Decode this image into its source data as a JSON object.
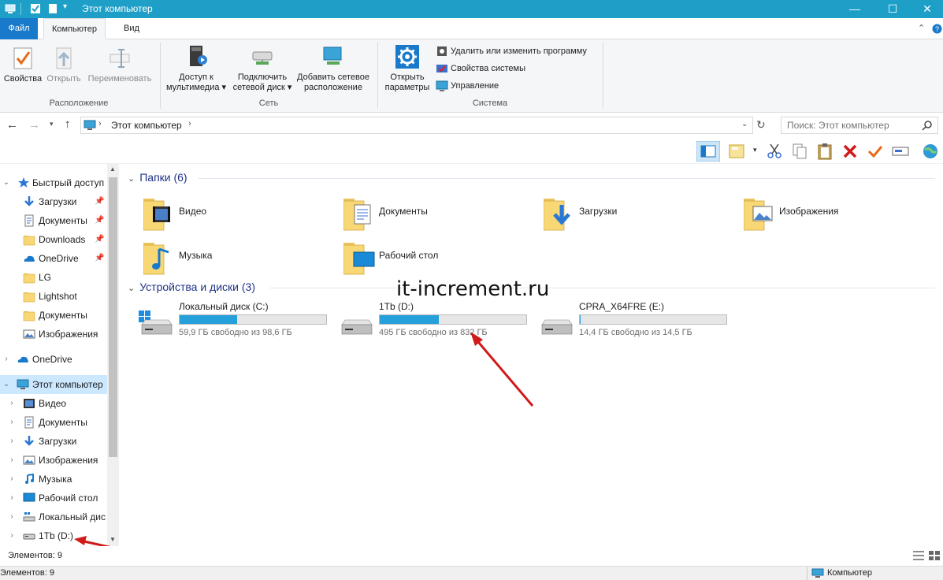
{
  "window": {
    "title": "Этот компьютер",
    "controls": [
      "—",
      "☐",
      "✕"
    ]
  },
  "ribbon_tabs": [
    "Файл",
    "Компьютер",
    "Вид"
  ],
  "ribbon": {
    "location": {
      "label": "Расположение",
      "buttons": [
        {
          "label": "Свойства",
          "enabled": true
        },
        {
          "label": "Открыть",
          "enabled": false
        },
        {
          "label": "Переименовать",
          "enabled": false
        }
      ]
    },
    "network": {
      "label": "Сеть",
      "buttons": [
        {
          "line1": "Доступ к",
          "line2": "мультимедиа ▾"
        },
        {
          "line1": "Подключить",
          "line2": "сетевой диск ▾"
        },
        {
          "line1": "Добавить сетевое",
          "line2": "расположение"
        }
      ]
    },
    "system": {
      "label": "Система",
      "open_settings": {
        "line1": "Открыть",
        "line2": "параметры"
      },
      "items": [
        "Удалить или изменить программу",
        "Свойства системы",
        "Управление"
      ]
    }
  },
  "address": {
    "path": "Этот компьютер",
    "search_placeholder": "Поиск: Этот компьютер"
  },
  "nav": {
    "quick_access": "Быстрый доступ",
    "quick_items": [
      "Загрузки",
      "Документы",
      "Downloads",
      "OneDrive",
      "LG",
      "Lightshot",
      "Документы",
      "Изображения"
    ],
    "onedrive": "OneDrive",
    "this_pc": "Этот компьютер",
    "pc_items": [
      "Видео",
      "Документы",
      "Загрузки",
      "Изображения",
      "Музыка",
      "Рабочий стол",
      "Локальный дис",
      "1Tb (D:)"
    ]
  },
  "content": {
    "folders_header": "Папки (6)",
    "folders": [
      "Видео",
      "Документы",
      "Загрузки",
      "Изображения",
      "Музыка",
      "Рабочий стол"
    ],
    "drives_header": "Устройства и диски (3)",
    "drives": [
      {
        "name": "Локальный диск (C:)",
        "free": "59,9 ГБ свободно из 98,6 ГБ",
        "used_fraction": 0.39
      },
      {
        "name": "1Tb (D:)",
        "free": "495 ГБ свободно из 832 ГБ",
        "used_fraction": 0.405
      },
      {
        "name": "CPRA_X64FRE (E:)",
        "free": "14,4 ГБ свободно из 14,5 ГБ",
        "used_fraction": 0.007
      }
    ]
  },
  "watermark": "it-increment.ru",
  "status": {
    "items_count": "Элементов: 9",
    "items_count_bottom": "Элементов: 9",
    "location": "Компьютер"
  },
  "colors": {
    "titlebar": "#1d9fc7",
    "file_tab": "#1979ca",
    "selection": "#cce8ff",
    "drive_bar": "#26a0da",
    "arrow": "#d11a1a"
  }
}
